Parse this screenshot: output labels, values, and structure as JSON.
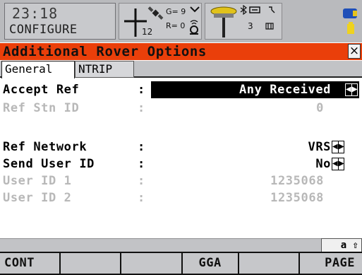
{
  "status": {
    "time": "23:18",
    "mode": "CONFIGURE",
    "gps_sats": "12",
    "g_count": "G= 9",
    "r_count": "R= 0",
    "link_count": "3",
    "colors": {
      "bg": "#b9babd",
      "panel": "#c8c9cc"
    },
    "icons": [
      "crosshair-icon",
      "satellite-icon",
      "antenna-icon",
      "gps-receiver-icon",
      "bluetooth-icon",
      "radio-icon",
      "battery-icon",
      "memory-icon"
    ]
  },
  "title": {
    "text": "Additional Rover Options",
    "close_label": "×",
    "color": "#ea3f0a"
  },
  "tabs": [
    {
      "label": "General",
      "active": true
    },
    {
      "label": "NTRIP",
      "active": false
    }
  ],
  "fields": {
    "accept_ref": {
      "label": "Accept Ref",
      "colon": ":",
      "value": "Any Received"
    },
    "ref_stn_id": {
      "label": "Ref Stn ID",
      "colon": ":",
      "value": "0"
    },
    "ref_network": {
      "label": "Ref Network",
      "colon": ":",
      "value": "VRS"
    },
    "send_user_id": {
      "label": "Send User ID",
      "colon": ":",
      "value": "No"
    },
    "user_id_1": {
      "label": "User ID 1",
      "colon": ":",
      "value": "1235068"
    },
    "user_id_2": {
      "label": "User ID 2",
      "colon": ":",
      "value": "1235068"
    }
  },
  "indicator": {
    "text": "a ⇧"
  },
  "fkeys": [
    "CONT",
    "",
    "",
    "GGA",
    "",
    "PAGE"
  ]
}
